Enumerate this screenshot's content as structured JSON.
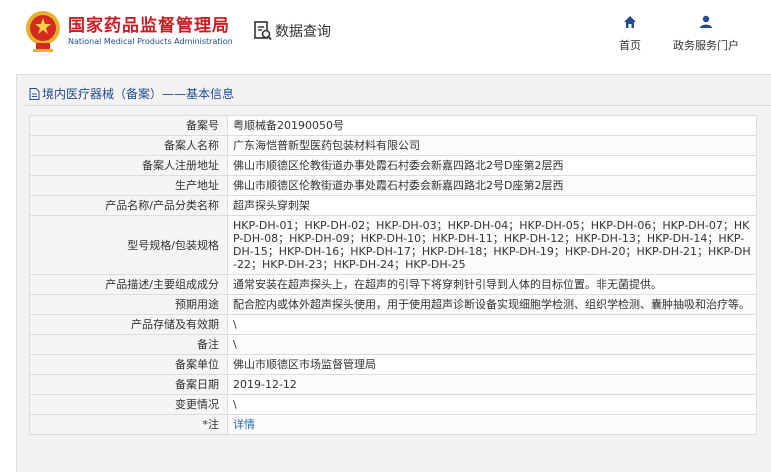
{
  "header": {
    "org_cn": "国家药品监督管理局",
    "org_en": "National Medical Products Administration",
    "query_label": "数据查询",
    "nav": [
      {
        "label": "首页",
        "icon": "home-icon"
      },
      {
        "label": "政务服务门户",
        "icon": "user-icon"
      }
    ]
  },
  "panel": {
    "title": "境内医疗器械（备案）——基本信息"
  },
  "record": [
    {
      "label": "备案号",
      "value": "粤顺械备20190050号"
    },
    {
      "label": "备案人名称",
      "value": "广东海恺普新型医药包装材料有限公司"
    },
    {
      "label": "备案人注册地址",
      "value": "佛山市顺德区伦教街道办事处霞石村委会新嘉四路北2号D座第2层西"
    },
    {
      "label": "生产地址",
      "value": "佛山市顺德区伦教街道办事处霞石村委会新嘉四路北2号D座第2层西"
    },
    {
      "label": "产品名称/产品分类名称",
      "value": "超声探头穿刺架"
    },
    {
      "label": "型号规格/包装规格",
      "value": "HKP-DH-01；HKP-DH-02；HKP-DH-03；HKP-DH-04；HKP-DH-05；HKP-DH-06；HKP-DH-07；HKP-DH-08；HKP-DH-09；HKP-DH-10；HKP-DH-11；HKP-DH-12；HKP-DH-13；HKP-DH-14；HKP-DH-15；HKP-DH-16；HKP-DH-17；HKP-DH-18；HKP-DH-19；HKP-DH-20；HKP-DH-21；HKP-DH-22；HKP-DH-23；HKP-DH-24；HKP-DH-25"
    },
    {
      "label": "产品描述/主要组成成分",
      "value": "通常安装在超声探头上，在超声的引导下将穿刺针引导到人体的目标位置。非无菌提供。"
    },
    {
      "label": "预期用途",
      "value": "配合腔内或体外超声探头使用，用于使用超声诊断设备实现细胞学检测、组织学检测、囊肿抽吸和治疗等。"
    },
    {
      "label": "产品存储及有效期",
      "value": "\\"
    },
    {
      "label": "备注",
      "value": "\\"
    },
    {
      "label": "备案单位",
      "value": "佛山市顺德区市场监督管理局"
    },
    {
      "label": "备案日期",
      "value": "2019-12-12"
    },
    {
      "label": "变更情况",
      "value": "\\"
    },
    {
      "label": "*注",
      "value": "详情"
    }
  ],
  "colors": {
    "brand_red": "#c81d24",
    "brand_blue": "#234c8c",
    "link_blue": "#2a6ab5"
  }
}
